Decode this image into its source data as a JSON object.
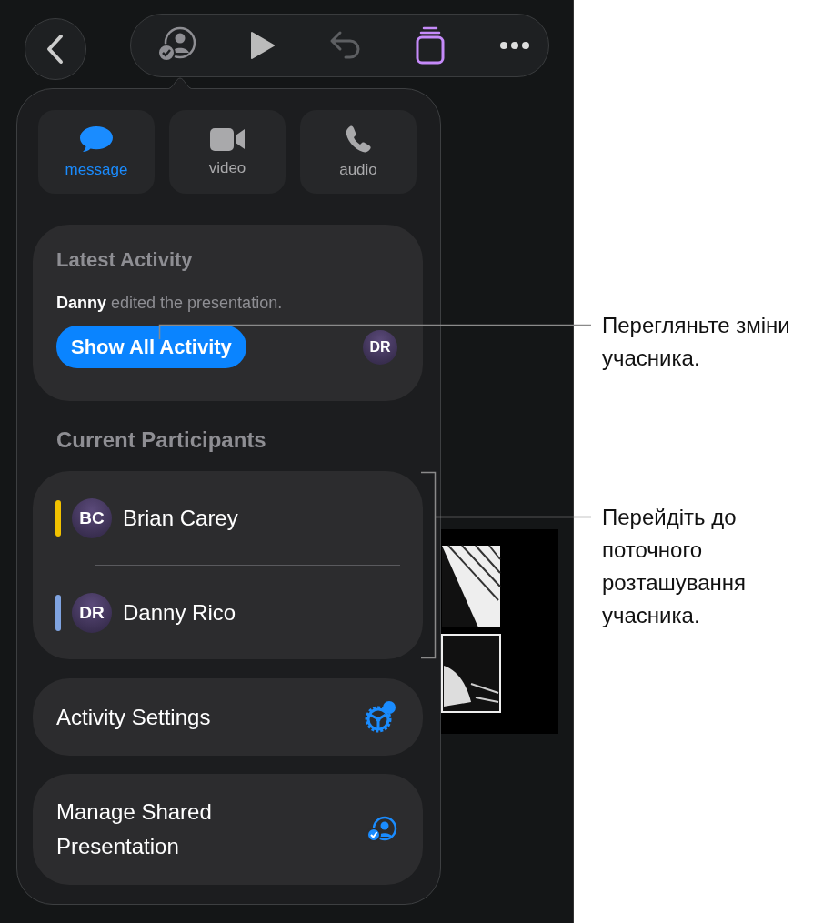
{
  "contact_options": [
    {
      "kind": "message",
      "label": "message",
      "selected": true
    },
    {
      "kind": "video",
      "label": "video",
      "selected": false
    },
    {
      "kind": "audio",
      "label": "audio",
      "selected": false
    }
  ],
  "latest_activity": {
    "title": "Latest Activity",
    "text": "**Danny** edited the presentation.",
    "button": "Show All Activity",
    "avatar": "DR"
  },
  "participants": {
    "title": "Current Participants",
    "items": [
      {
        "initials": "BC",
        "name": "Brian Carey",
        "color": "#f2c200"
      },
      {
        "initials": "DR",
        "name": "Danny Rico",
        "color": "#7fa3e0"
      }
    ]
  },
  "actions": [
    {
      "kind": "settings",
      "label": "Activity Settings"
    },
    {
      "kind": "manage",
      "label": "Manage Shared Presentation"
    }
  ],
  "callouts": [
    "Перегляньте зміни учасника.",
    "Перейдіть до поточного розташування учасника."
  ]
}
